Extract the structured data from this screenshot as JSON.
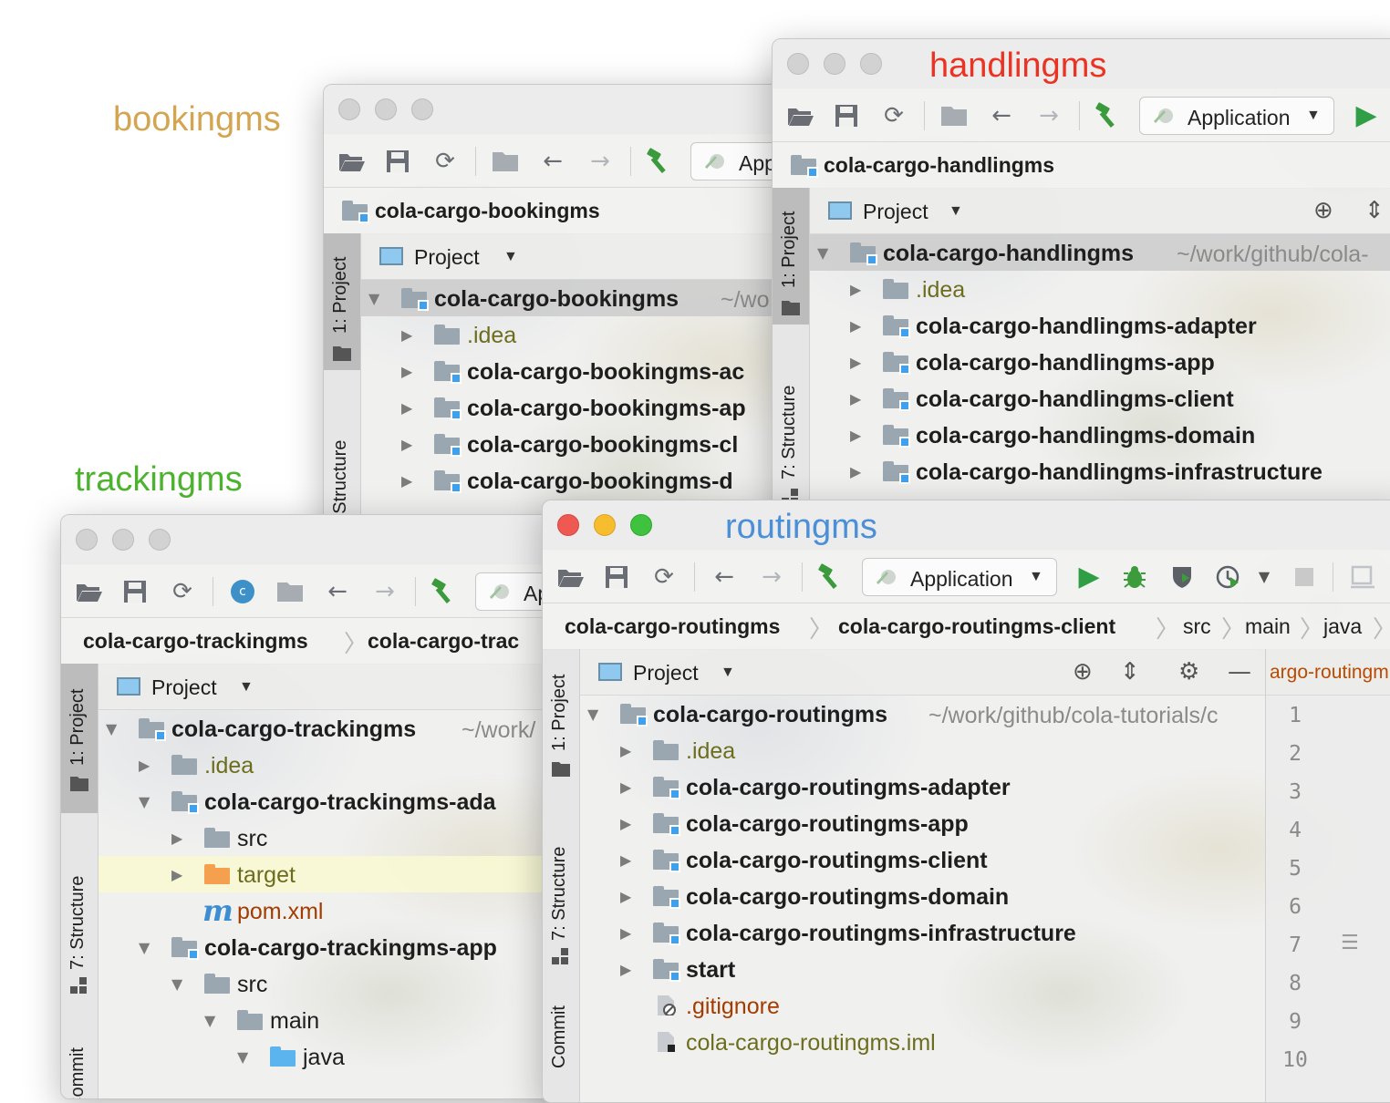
{
  "labels": {
    "bookingms": "bookingms",
    "handlingms": "handlingms",
    "trackingms": "trackingms",
    "routingms": "routingms"
  },
  "label_colors": {
    "bookingms": "#d4a551",
    "handlingms": "#ea3323",
    "trackingms": "#4db32f",
    "routingms": "#4a8fd8"
  },
  "common": {
    "run_config": "Application",
    "run_config_partial": "App",
    "run_config_partial_short": "Ap",
    "project_view": "Project",
    "stripe_project": "1: Project",
    "stripe_structure": "7: Structure",
    "stripe_commit": "Commit"
  },
  "bookingms": {
    "navbar": "cola-cargo-bookingms",
    "root": "cola-cargo-bookingms",
    "root_path": "~/wo",
    "items": [
      ".idea",
      "cola-cargo-bookingms-ac",
      "cola-cargo-bookingms-ap",
      "cola-cargo-bookingms-cl",
      "cola-cargo-bookingms-d"
    ]
  },
  "handlingms": {
    "navbar": "cola-cargo-handlingms",
    "root": "cola-cargo-handlingms",
    "root_path": "~/work/github/cola-",
    "items": [
      ".idea",
      "cola-cargo-handlingms-adapter",
      "cola-cargo-handlingms-app",
      "cola-cargo-handlingms-client",
      "cola-cargo-handlingms-domain",
      "cola-cargo-handlingms-infrastructure"
    ]
  },
  "trackingms": {
    "breadcrumb": [
      "cola-cargo-trackingms",
      "cola-cargo-trac"
    ],
    "root": "cola-cargo-trackingms",
    "root_path": "~/work/",
    "items": [
      ".idea",
      "cola-cargo-trackingms-ada",
      "src",
      "target",
      "pom.xml",
      "cola-cargo-trackingms-app",
      "src",
      "main",
      "java"
    ]
  },
  "routingms": {
    "breadcrumb": [
      "cola-cargo-routingms",
      "cola-cargo-routingms-client",
      "src",
      "main",
      "java"
    ],
    "root": "cola-cargo-routingms",
    "root_path": "~/work/github/cola-tutorials/c",
    "items": [
      ".idea",
      "cola-cargo-routingms-adapter",
      "cola-cargo-routingms-app",
      "cola-cargo-routingms-client",
      "cola-cargo-routingms-domain",
      "cola-cargo-routingms-infrastructure",
      "start",
      ".gitignore",
      "cola-cargo-routingms.iml"
    ],
    "editor_tab": "argo-routingm",
    "line_numbers": [
      "1",
      "2",
      "3",
      "4",
      "5",
      "6",
      "7",
      "8",
      "9",
      "10"
    ]
  },
  "icons": {
    "open": "folder-open-icon",
    "save": "save-icon",
    "sync": "sync-icon",
    "back": "arrow-left-icon",
    "forward": "arrow-right-icon",
    "build": "hammer-icon",
    "run": "run-icon",
    "debug": "bug-icon",
    "coverage": "coverage-icon",
    "profile": "profile-icon",
    "stop": "stop-icon",
    "locate": "crosshair-icon",
    "collapse": "collapse-all-icon",
    "settings": "gear-icon",
    "hide": "minimize-icon"
  }
}
